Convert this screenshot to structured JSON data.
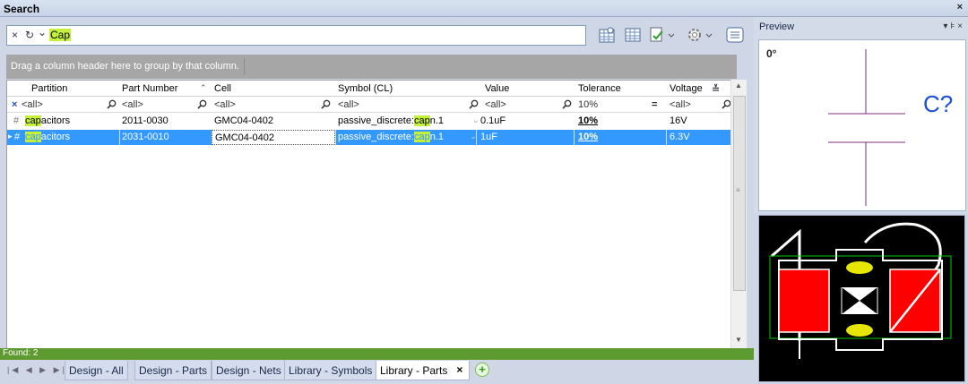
{
  "window": {
    "title": "Search",
    "close": "×"
  },
  "search": {
    "query": "Cap",
    "clear": "×",
    "refresh": "↻",
    "dropdown": "⌄"
  },
  "group_hint": "Drag a column header here to group by that column.",
  "columns": [
    "Partition",
    "Part Number",
    "Cell",
    "Symbol (CL)",
    "Value",
    "Tolerance",
    "Voltage"
  ],
  "filters": [
    "<all>",
    "<all>",
    "<all>",
    "<all>",
    "<all>",
    "10%",
    "<all>"
  ],
  "rows": [
    {
      "partition_hl": "cap",
      "partition_rest": "acitors",
      "part_number": "2011-0030",
      "cell": "GMC04-0402",
      "symbol_pre": "passive_discrete:",
      "symbol_hl": "cap",
      "symbol_post": "n.1",
      "value": "0.1uF",
      "tolerance": "10%",
      "voltage": "16V"
    },
    {
      "partition_hl": "cap",
      "partition_rest": "acitors",
      "part_number": "2031-0010",
      "cell": "GMC04-0402",
      "symbol_pre": "passive_discrete:",
      "symbol_hl": "cap",
      "symbol_post": "n.1",
      "value": "1uF",
      "tolerance": "10%",
      "voltage": "6.3V"
    }
  ],
  "status": "Found: 2",
  "tabs": [
    "Design - All",
    "Design - Parts",
    "Design - Nets",
    "Library - Symbols",
    "Library - Parts"
  ],
  "tab_nav": "|◀ ◀ ▶ ▶|",
  "preview": {
    "title": "Preview",
    "controls": "▾ ⊧ ×",
    "rotation": "0°",
    "refdes": "C?"
  },
  "colors": {
    "selection": "#3399ff",
    "highlight": "#c5f03c",
    "status_bar": "#5d9a2f",
    "pad_red": "#ff0000",
    "outline_green": "#00d000"
  },
  "icons": {
    "add_tab": "plus-icon",
    "toolbar": [
      "grid-icon",
      "table-icon",
      "export-icon",
      "gear-icon",
      "list-icon"
    ]
  }
}
